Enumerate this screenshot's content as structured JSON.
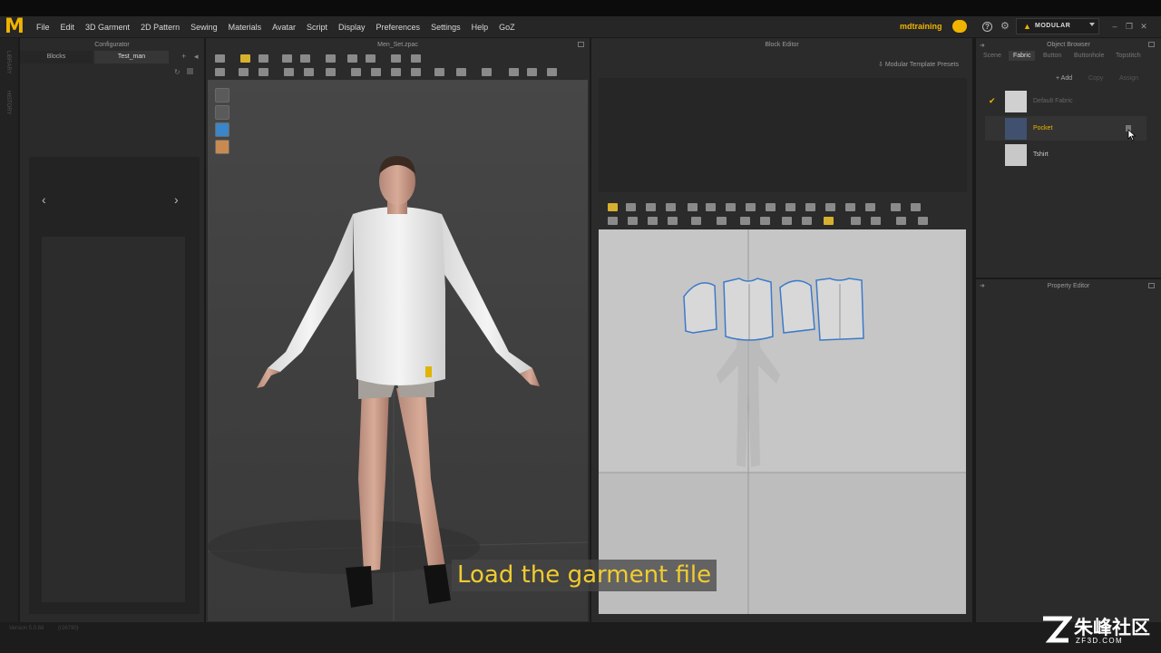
{
  "app": {
    "logo": "M",
    "menu": [
      "File",
      "Edit",
      "3D Garment",
      "2D Pattern",
      "Sewing",
      "Materials",
      "Avatar",
      "Script",
      "Display",
      "Preferences",
      "Settings",
      "Help",
      "GoZ"
    ],
    "user_name": "mdtraining",
    "mode_label": "MODULAR"
  },
  "left_strip": {
    "labels": [
      "LIBRARY",
      "HISTORY"
    ]
  },
  "configurator": {
    "title": "Configurator",
    "tabs": [
      "Blocks",
      "Test_man"
    ]
  },
  "viewport": {
    "title": "Men_Set.zpac"
  },
  "block_editor": {
    "title": "Block Editor",
    "presets_button": "Modular Template Presets"
  },
  "object_browser": {
    "title": "Object Browser",
    "tabs": [
      "Scene",
      "Fabric",
      "Button",
      "Buttonhole",
      "Topstitch"
    ],
    "active_tab": "Fabric",
    "actions": [
      "+ Add",
      "Copy",
      "Assign"
    ],
    "items": [
      {
        "name": "Default Fabric",
        "checked": true,
        "color": "#d0d0d0"
      },
      {
        "name": "Pocket",
        "checked": false,
        "color": "#41506e"
      },
      {
        "name": "Tshirt",
        "checked": false,
        "color": "#c8c8c8"
      }
    ]
  },
  "property_editor": {
    "title": "Property Editor"
  },
  "status": {
    "version": "Version 5.0.68",
    "build": "(r26790)"
  },
  "subtitle": "Load the garment file",
  "watermark": {
    "title": "朱峰社区",
    "url": "ZF3D.COM"
  }
}
